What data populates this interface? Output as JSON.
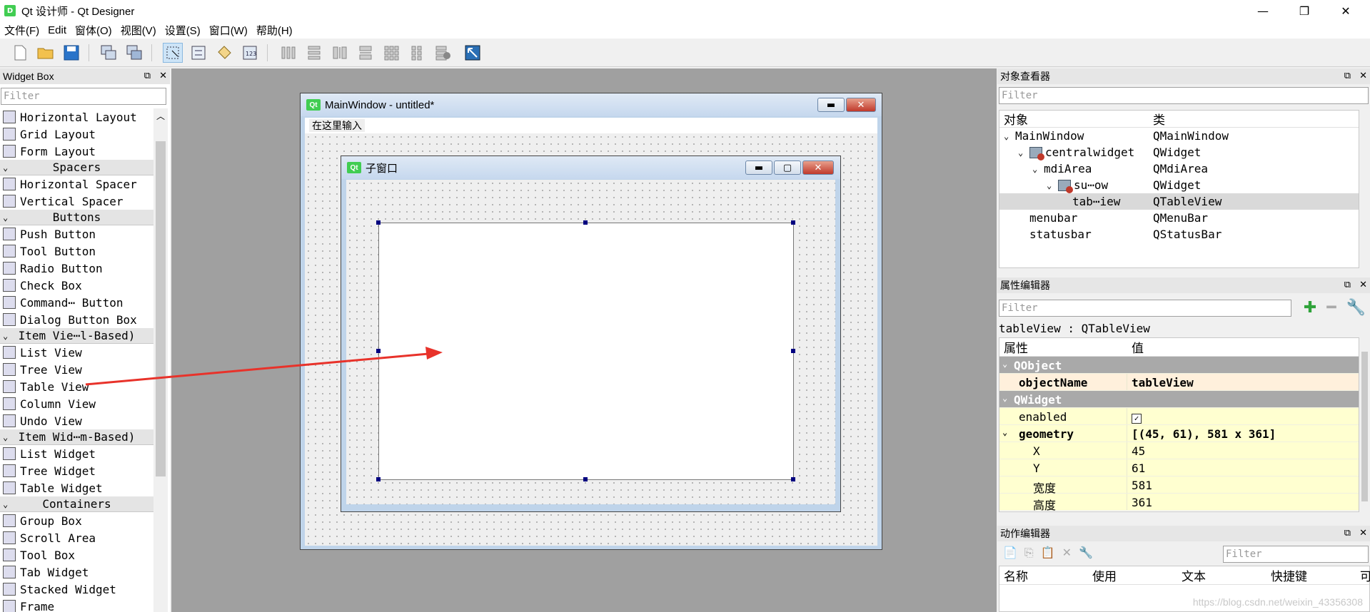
{
  "app": {
    "title": "Qt 设计师 - Qt Designer",
    "icon": "D"
  },
  "menubar": [
    "文件(F)",
    "Edit",
    "窗体(O)",
    "视图(V)",
    "设置(S)",
    "窗口(W)",
    "帮助(H)"
  ],
  "widget_box": {
    "title": "Widget Box",
    "filter_placeholder": "Filter",
    "rows": [
      {
        "type": "item",
        "label": "Horizontal Layout",
        "icon": "horizontal-layout-icon"
      },
      {
        "type": "item",
        "label": "Grid Layout",
        "icon": "grid-layout-icon"
      },
      {
        "type": "item",
        "label": "Form Layout",
        "icon": "form-layout-icon"
      },
      {
        "type": "cat",
        "label": "Spacers"
      },
      {
        "type": "item",
        "label": "Horizontal Spacer",
        "icon": "horizontal-spacer-icon"
      },
      {
        "type": "item",
        "label": "Vertical Spacer",
        "icon": "vertical-spacer-icon"
      },
      {
        "type": "cat",
        "label": "Buttons"
      },
      {
        "type": "item",
        "label": "Push Button",
        "icon": "push-button-icon"
      },
      {
        "type": "item",
        "label": "Tool Button",
        "icon": "tool-button-icon"
      },
      {
        "type": "item",
        "label": "Radio Button",
        "icon": "radio-button-icon"
      },
      {
        "type": "item",
        "label": "Check Box",
        "icon": "check-box-icon"
      },
      {
        "type": "item",
        "label": "Command⋯ Button",
        "icon": "command-link-icon"
      },
      {
        "type": "item",
        "label": "Dialog Button Box",
        "icon": "dialog-button-box-icon"
      },
      {
        "type": "cat",
        "label": "Item Vie⋯l-Based)"
      },
      {
        "type": "item",
        "label": "List View",
        "icon": "list-view-icon"
      },
      {
        "type": "item",
        "label": "Tree View",
        "icon": "tree-view-icon"
      },
      {
        "type": "item",
        "label": "Table View",
        "icon": "table-view-icon"
      },
      {
        "type": "item",
        "label": "Column View",
        "icon": "column-view-icon"
      },
      {
        "type": "item",
        "label": "Undo View",
        "icon": "undo-view-icon"
      },
      {
        "type": "cat",
        "label": "Item Wid⋯m-Based)"
      },
      {
        "type": "item",
        "label": "List Widget",
        "icon": "list-widget-icon"
      },
      {
        "type": "item",
        "label": "Tree Widget",
        "icon": "tree-widget-icon"
      },
      {
        "type": "item",
        "label": "Table Widget",
        "icon": "table-widget-icon"
      },
      {
        "type": "cat",
        "label": "Containers"
      },
      {
        "type": "item",
        "label": "Group Box",
        "icon": "group-box-icon"
      },
      {
        "type": "item",
        "label": "Scroll Area",
        "icon": "scroll-area-icon"
      },
      {
        "type": "item",
        "label": "Tool Box",
        "icon": "tool-box-icon"
      },
      {
        "type": "item",
        "label": "Tab Widget",
        "icon": "tab-widget-icon"
      },
      {
        "type": "item",
        "label": "Stacked Widget",
        "icon": "stacked-widget-icon"
      },
      {
        "type": "item",
        "label": "Frame",
        "icon": "frame-icon"
      }
    ]
  },
  "form": {
    "main_window_title": "MainWindow - untitled*",
    "type_here": "在这里输入",
    "sub_window_title": "子窗口",
    "qt_badge": "Qt"
  },
  "object_inspector": {
    "title": "对象查看器",
    "filter_placeholder": "Filter",
    "col_object": "对象",
    "col_class": "类",
    "rows": [
      {
        "indent": 0,
        "arrow": "⌄",
        "icon": false,
        "obj": "MainWindow",
        "cls": "QMainWindow",
        "sel": false
      },
      {
        "indent": 1,
        "arrow": "⌄",
        "icon": true,
        "obj": "centralwidget",
        "cls": "QWidget",
        "sel": false
      },
      {
        "indent": 2,
        "arrow": "⌄",
        "icon": false,
        "obj": "mdiArea",
        "cls": "QMdiArea",
        "sel": false
      },
      {
        "indent": 3,
        "arrow": "⌄",
        "icon": true,
        "obj": "su⋯ow",
        "cls": "QWidget",
        "sel": false
      },
      {
        "indent": 4,
        "arrow": "",
        "icon": false,
        "obj": "tab⋯iew",
        "cls": "QTableView",
        "sel": true
      },
      {
        "indent": 1,
        "arrow": "",
        "icon": false,
        "obj": "menubar",
        "cls": "QMenuBar",
        "sel": false
      },
      {
        "indent": 1,
        "arrow": "",
        "icon": false,
        "obj": "statusbar",
        "cls": "QStatusBar",
        "sel": false
      }
    ]
  },
  "property_editor": {
    "title": "属性编辑器",
    "filter_placeholder": "Filter",
    "object_line": "tableView : QTableView",
    "col_prop": "属性",
    "col_value": "值",
    "rows": [
      {
        "kind": "group",
        "name": "QObject",
        "value": ""
      },
      {
        "kind": "orange",
        "name": "objectName",
        "value": "tableView",
        "bold": true
      },
      {
        "kind": "group",
        "name": "QWidget",
        "value": ""
      },
      {
        "kind": "yellow",
        "name": "enabled",
        "value": "✓",
        "check": true
      },
      {
        "kind": "yellow",
        "name": "geometry",
        "value": "[(45, 61), 581 x 361]",
        "bold": true,
        "arrow": "⌄"
      },
      {
        "kind": "yellow",
        "name": "X",
        "value": "45",
        "sub": true
      },
      {
        "kind": "yellow",
        "name": "Y",
        "value": "61",
        "sub": true
      },
      {
        "kind": "yellow",
        "name": "宽度",
        "value": "581",
        "sub": true
      },
      {
        "kind": "yellow",
        "name": "高度",
        "value": "361",
        "sub": true
      }
    ]
  },
  "action_editor": {
    "title": "动作编辑器",
    "filter_placeholder": "Filter",
    "cols": [
      "名称",
      "使用",
      "文本",
      "快捷键",
      "可"
    ]
  },
  "watermark": "https://blog.csdn.net/weixin_43356308",
  "colors": {
    "accent": "#41cd52",
    "arrow": "#e8322a",
    "selection": "#000080"
  }
}
